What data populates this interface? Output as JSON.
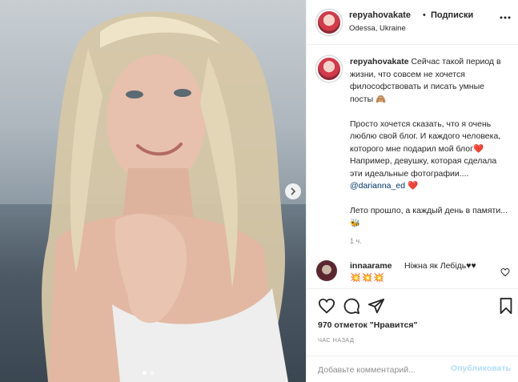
{
  "post": {
    "author": {
      "username": "repyahovakate",
      "separator": "•",
      "follow_label": "Подписки",
      "location": "Odessa, Ukraine"
    },
    "caption": {
      "username": "repyahovakate",
      "line1": " Сейчас такой период в жизни, что совсем не хочется философствовать и писать умные посты 🙈",
      "line2": "Просто хочется сказать, что я очень люблю свой блог. И каждого человека, которого мне подарил мой блог",
      "line3": "Например, девушку, которая сделала эти идеальные фотографии.... ",
      "mention": "@darianna_ed",
      "line4": "Лето прошло, а каждый день в памяти...🐝",
      "heart": "❤️",
      "time": "1 ч."
    },
    "comment": {
      "username": "innaarame",
      "text": "Ніжна як Лебідь♥♥",
      "emoji": "💥💥💥"
    },
    "likes": "970 отметок \"Нравится\"",
    "time_ago": "ЧАС НАЗАД",
    "add_comment_placeholder": "Добавьте комментарий...",
    "post_button": "Опубликовать",
    "carousel": {
      "slides": 2,
      "active_index": 0
    }
  },
  "icons": [
    "more-icon",
    "heart-icon",
    "comment-icon",
    "share-icon",
    "bookmark-icon",
    "chevron-right-icon"
  ],
  "colors": {
    "link": "#00376b",
    "muted": "#8e8e8e",
    "post_disabled": "#b2dffc",
    "heart": "#e0163b"
  }
}
